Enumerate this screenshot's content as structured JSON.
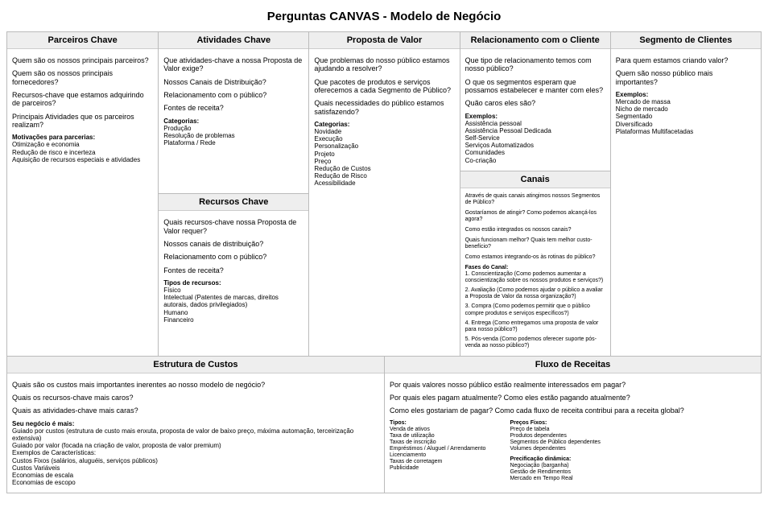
{
  "title": "Perguntas CANVAS - Modelo de Negócio",
  "partners": {
    "header": "Parceiros Chave",
    "q1": "Quem são os nossos principais parceiros?",
    "q2": "Quem são os nossos principais fornecedores?",
    "q3": "Recursos-chave que estamos adquirindo de parceiros?",
    "q4": "Principais Atividades que os parceiros realizam?",
    "motiv_label": "Motivações para parcerias:",
    "m1": "Otimização e economia",
    "m2": "Redução de risco e incerteza",
    "m3": "Aquisição de recursos especiais e atividades"
  },
  "activities": {
    "header": "Atividades Chave",
    "q1": "Que atividades-chave a nossa Proposta de Valor exige?",
    "q2": "Nossos Canais de Distribuição?",
    "q3": "Relacionamento com o público?",
    "q4": "Fontes de receita?",
    "cat_label": "Categorias:",
    "c1": "Produção",
    "c2": "Resolução de problemas",
    "c3": "Plataforma / Rede"
  },
  "resources": {
    "header": "Recursos Chave",
    "q1": "Quais recursos-chave nossa Proposta de Valor requer?",
    "q2": "Nossos canais de distribuição?",
    "q3": "Relacionamento com o público?",
    "q4": "Fontes de receita?",
    "types_label": "Tipos de recursos:",
    "t1": "Físico",
    "t2": "Intelectual (Patentes de marcas, direitos autorais, dados privilegiados)",
    "t3": "Humano",
    "t4": "Financeiro"
  },
  "value": {
    "header": "Proposta de Valor",
    "q1": "Que problemas do nosso público estamos ajudando a resolver?",
    "q2": "Que pacotes de produtos e serviços oferecemos a cada Segmento de Público?",
    "q3": "Quais necessidades do público estamos satisfazendo?",
    "cat_label": "Categorias:",
    "c1": "Novidade",
    "c2": "Execução",
    "c3": "Personalização",
    "c4": "Projeto",
    "c5": "Preço",
    "c6": "Redução de Custos",
    "c7": "Redução de Risco",
    "c8": "Acessibilidade"
  },
  "relationship": {
    "header": "Relacionamento com o Cliente",
    "q1": "Que tipo de relacionamento temos com nosso público?",
    "q2": "O que os segmentos esperam que possamos estabelecer e manter com eles?",
    "q3": "Quão caros eles são?",
    "ex_label": "Exemplos:",
    "e1": "Assistência pessoal",
    "e2": "Assistência Pessoal Dedicada",
    "e3": "Self-Service",
    "e4": "Serviços Automatizados",
    "e5": "Comunidades",
    "e6": "Co-criação"
  },
  "channels": {
    "header": "Canais",
    "q1": "Através de quais canais atingimos nossos Segmentos de Público?",
    "q2": "Gostaríamos de atingir? Como podemos alcançá-los agora?",
    "q3": "Como estão integrados os nossos canais?",
    "q4": "Quais funcionam melhor? Quais tem melhor custo-benefício?",
    "q5": "Como estamos integrando-os às rotinas do público?",
    "phases_label": "Fases do Canal:",
    "p1": "1. Conscientização (Como podemos aumentar a conscientização sobre os nossos produtos e serviços?)",
    "p2": "2. Avaliação (Como podemos ajudar o público a avaliar a Proposta de Valor da nossa organização?)",
    "p3": "3. Compra (Como podemos permitir que o público compre produtos e serviços específicos?)",
    "p4": "4. Entrega (Como entregamos uma proposta de valor para nosso público?)",
    "p5": "5. Pós-venda (Como podemos oferecer suporte pós-venda ao nosso público?)"
  },
  "segments": {
    "header": "Segmento de Clientes",
    "q1": "Para quem estamos criando valor?",
    "q2": "Quem são nosso público mais importantes?",
    "ex_label": "Exemplos:",
    "e1": "Mercado de massa",
    "e2": "Nicho de mercado",
    "e3": "Segmentado",
    "e4": "Diversificado",
    "e5": "Plataformas Multifacetadas"
  },
  "costs": {
    "header": "Estrutura de Custos",
    "q1": "Quais são os custos mais importantes inerentes ao nosso modelo de negócio?",
    "q2": "Quais os recursos-chave mais caros?",
    "q3": "Quais as atividades-chave mais caras?",
    "biz_label": "Seu negócio é mais:",
    "b1": "Guiado por custos (estrutura de custo mais enxuta, proposta de valor de baixo preço, máxima automação, terceirização extensiva)",
    "b2": "Guiado por valor (focada na criação de valor, proposta de valor premium)",
    "b3": "Exemplos de Características:",
    "b4": "Custos Fixos (salários, aluguéis, serviços públicos)",
    "b5": "Custos Variáveis",
    "b6": "Economias de escala",
    "b7": "Economias de escopo"
  },
  "revenue": {
    "header": "Fluxo de Receitas",
    "q1": "Por quais valores nosso público estão realmente interessados em pagar?",
    "q2": "Por quais eles pagam atualmente? Como eles estão pagando atualmente?",
    "q3": "Como eles gostariam de pagar? Como cada fluxo de receita contribui para a receita global?",
    "types_label": "Tipos:",
    "t1": "Venda de ativos",
    "t2": "Taxa de utilização",
    "t3": "Taxas de inscrição",
    "t4": "Empréstimos / Aluguel / Arrendamento",
    "t5": "Licenciamento",
    "t6": "Taxas de corretagem",
    "t7": "Publicidade",
    "fixed_label": "Preços Fixos:",
    "f1": "Preço de tabela",
    "f2": "Produtos dependentes",
    "f3": "Segmentos de Público dependentes",
    "f4": "Volumes dependentes",
    "dyn_label": "Precificação dinâmica:",
    "d1": "Negociação (barganha)",
    "d2": "Gestão de Rendimentos",
    "d3": "Mercado em Tempo Real"
  }
}
